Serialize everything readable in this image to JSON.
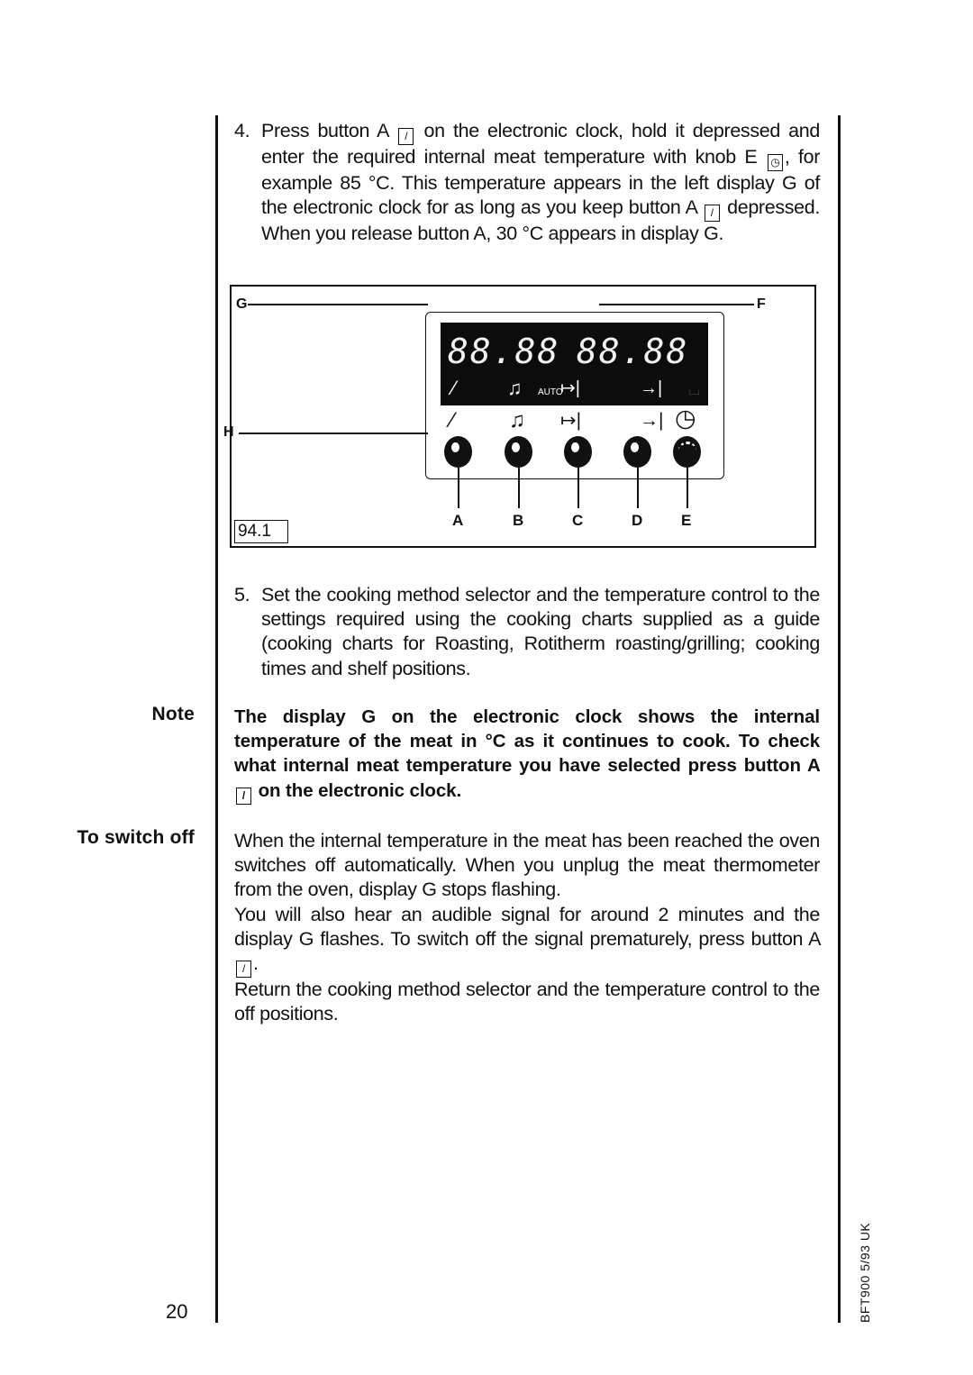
{
  "page": {
    "number": "20",
    "footer_code": "BFT900 5/93   UK"
  },
  "side_headings": {
    "note": "Note",
    "switch_off": "To switch off"
  },
  "step4": {
    "number": "4.",
    "part1": "Press button A",
    "part2": "on the electronic clock, hold it depressed and enter the required internal meat temperature with knob E",
    "part3": ", for example 85 °C. This temperature appears in the left display G of the electronic clock for as long as you keep button A",
    "part4": "depressed. When you release button A, 30 °C appears in display G.",
    "icon_a": "meat-probe-icon",
    "icon_e": "clock-icon"
  },
  "figure": {
    "id": "94.1",
    "left_display": "88.88",
    "right_display": "88.88",
    "lcd_auto": "AUTO",
    "callouts": {
      "g": "G",
      "f": "F",
      "h": "H"
    },
    "buttons": [
      {
        "label": "A",
        "icon": "meat-probe-icon",
        "glyph": "⁄"
      },
      {
        "label": "B",
        "icon": "bell-icon",
        "glyph": "🔔︎"
      },
      {
        "label": "C",
        "icon": "duration-icon",
        "glyph": "↦|"
      },
      {
        "label": "D",
        "icon": "end-time-icon",
        "glyph": "→|"
      },
      {
        "label": "E",
        "icon": "clock-icon",
        "glyph": "◷"
      }
    ]
  },
  "step5": {
    "number": "5.",
    "text": "Set the cooking method selector and the temperature control to the settings required using the cooking charts supplied as a guide (cooking charts for Roasting, Rotitherm roasting/grilling; cooking times and shelf positions."
  },
  "note": {
    "part1": "The display G on the electronic clock shows the internal temperature of the meat in °C as it continues to cook. To check what internal meat temperature you have selected press button A",
    "part2": "on the electronic clock."
  },
  "switch_off": {
    "p1": "When the internal temperature in the meat has been reached the oven switches off automatically. When you unplug the meat thermometer from the oven, display G stops flashing.",
    "p2a": "You will also hear an audible signal for around 2 minutes and the display G flashes. To switch off the signal prematurely, press button A",
    "p2b": ".",
    "p3": "Return the cooking method selector and the temperature control to the off positions."
  }
}
